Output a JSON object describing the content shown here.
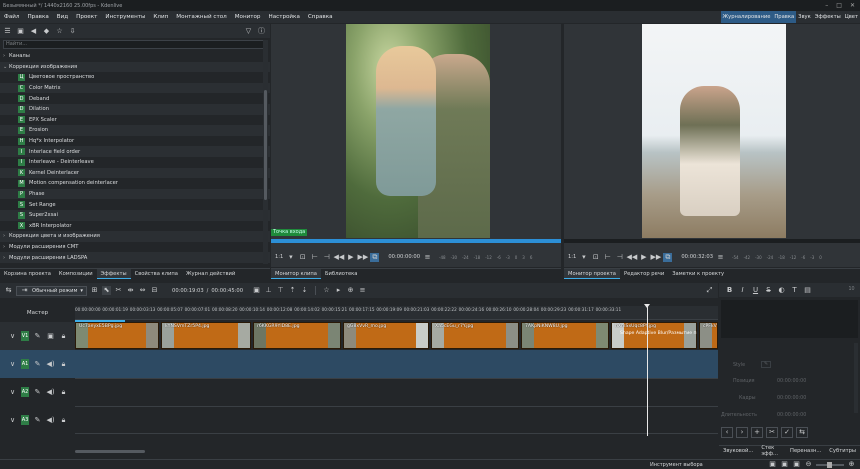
{
  "titlebar": {
    "title": "Безымянный */ 1440x2160 25.00fps - Kdenlive"
  },
  "menu": {
    "items": [
      "Файл",
      "Правка",
      "Вид",
      "Проект",
      "Инструменты",
      "Клип",
      "Монтажный стол",
      "Монитор",
      "Настройка",
      "Справка"
    ],
    "workspaces": [
      "Журналирование",
      "Правка",
      "Звук",
      "Эффекты",
      "Цвет"
    ],
    "active_workspace": "Правка"
  },
  "effects": {
    "search_placeholder": "Найти...",
    "rows": [
      {
        "type": "cat",
        "label": "Каналы"
      },
      {
        "type": "cat-open",
        "label": "Коррекция изображения"
      },
      {
        "type": "item",
        "icon": "Ц",
        "label": "Цветовое пространство"
      },
      {
        "type": "item",
        "icon": "C",
        "label": "Color Matrix"
      },
      {
        "type": "item",
        "icon": "D",
        "label": "Deband"
      },
      {
        "type": "item",
        "icon": "D",
        "label": "Dilation"
      },
      {
        "type": "item",
        "icon": "E",
        "label": "EPX Scaler"
      },
      {
        "type": "item",
        "icon": "E",
        "label": "Erosion"
      },
      {
        "type": "item",
        "icon": "H",
        "label": "Hq*x Interpolator"
      },
      {
        "type": "item",
        "icon": "I",
        "label": "Interlace field order"
      },
      {
        "type": "item",
        "icon": "I",
        "label": "Interleave - Deinterleave"
      },
      {
        "type": "item",
        "icon": "K",
        "label": "Kernel Deinterlacer"
      },
      {
        "type": "item",
        "icon": "M",
        "label": "Motion compensation deinterlacer"
      },
      {
        "type": "item",
        "icon": "P",
        "label": "Phase"
      },
      {
        "type": "item",
        "icon": "S",
        "label": "Set Range"
      },
      {
        "type": "item",
        "icon": "S",
        "label": "Super2xsai"
      },
      {
        "type": "item",
        "icon": "X",
        "label": "xBR Interpolator"
      },
      {
        "type": "cat",
        "label": "Коррекция цвета и изображения"
      },
      {
        "type": "cat",
        "label": "Модули расширения CMT"
      },
      {
        "type": "cat",
        "label": "Модули расширения LADSPA"
      }
    ]
  },
  "clip_monitor": {
    "label": "Точка входа",
    "zoom": "1:1",
    "timecode": "00:00:00:00",
    "db_scale": [
      "-48",
      "-30",
      "-24",
      "-18",
      "-12",
      "-6",
      "-3",
      "0",
      "3",
      "6"
    ]
  },
  "project_monitor": {
    "zoom": "1:1",
    "timecode": "00:00:32:03",
    "db_scale": [
      "-54",
      "-42",
      "-30",
      "-24",
      "-18",
      "-12",
      "-6",
      "-3",
      "0"
    ]
  },
  "left_tabs": [
    "Корзина проекта",
    "Композиции",
    "Эффекты",
    "Свойства клипа",
    "Журнал действий"
  ],
  "left_tabs_active": "Эффекты",
  "clip_tabs": [
    "Монитор клипа",
    "Библиотека"
  ],
  "clip_tabs_active": "Монитор клипа",
  "project_tabs": [
    "Монитор проекта",
    "Редактор речи",
    "Заметки к проекту"
  ],
  "project_tabs_active": "Монитор проекта",
  "timeline_toolbar": {
    "mode": "Обычный режим",
    "position": "00:00:19:03",
    "duration": "00:00:45:00"
  },
  "tracks": {
    "master": "Мастер",
    "labels": [
      "V1",
      "A1",
      "A2",
      "A3"
    ]
  },
  "ruler_ticks": [
    "00:00:00:00",
    "00:00:01:19",
    "00:00:03:13",
    "00:00:05:07",
    "00:00:07:01",
    "00:00:08:20",
    "00:00:10:14",
    "00:00:12:08",
    "00:00:14:02",
    "00:00:15:21",
    "00:00:17:15",
    "00:00:19:09",
    "00:00:21:03",
    "00:00:22:22",
    "00:00:24:16",
    "00:00:26:10",
    "00:00:28:04",
    "00:00:29:23",
    "00:00:31:17",
    "00:00:33:11"
  ],
  "clips": [
    {
      "name": "Uc7aeyxE5BPg.jpg"
    },
    {
      "name": "kYNSVmTZr5P4.jpg"
    },
    {
      "name": "r6KKGR9YlD8E.jpg"
    },
    {
      "name": "gG8xVvR_mo.jpg"
    },
    {
      "name": "Xa5cEGu_r7Y.jpg"
    },
    {
      "name": "7AKpNiKNW8U.jpg"
    },
    {
      "name": "hXmSxUqc8PY.jpg"
    },
    {
      "name": "cPFkV4qgLe8.jpg"
    },
    {
      "name": "Kqh"
    }
  ],
  "clip_effect_label": "Shape Adaptive Blur/Размытие п",
  "right_panel": {
    "style_label": "Style",
    "fields": [
      "Позиция",
      "Кадры",
      "Длительность"
    ],
    "placeholder": "00:00:00:00",
    "bottom_tabs": [
      "Звуковой...",
      "Стек эфф...",
      "Переназн...",
      "Субтитры"
    ]
  },
  "status": {
    "tool": "Инструмент выбора"
  }
}
